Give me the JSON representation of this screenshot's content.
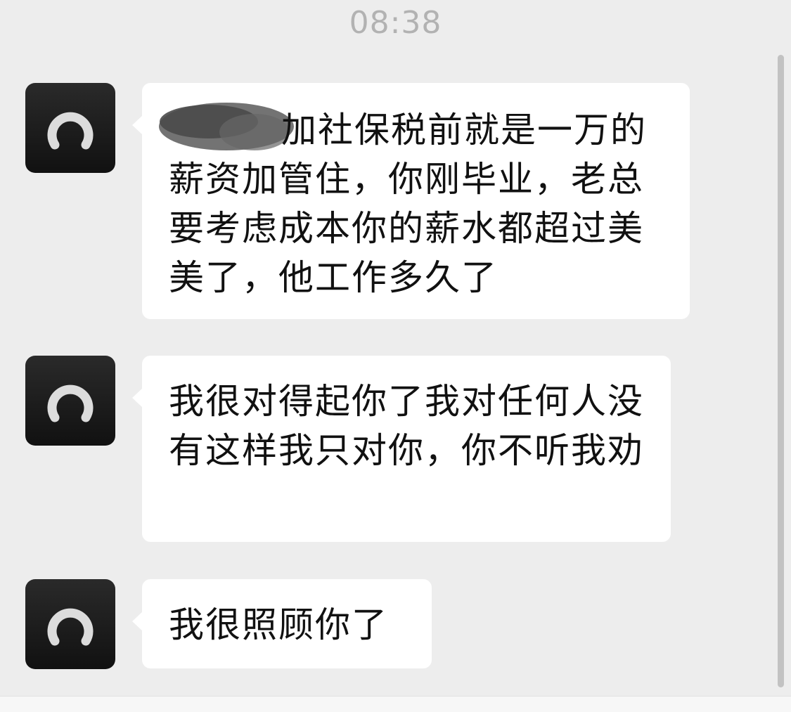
{
  "chat": {
    "timestamp": "08:38",
    "messages": [
      {
        "text": "加社保税前就是一万的薪资加管住，你刚毕业，老总要考虑成本你的薪水都超过美美了，他工作多久了"
      },
      {
        "text": "我很对得起你了我对任何人没有这样我只对你，你不听我劝"
      },
      {
        "text": "我很照顾你了"
      }
    ]
  },
  "colors": {
    "background": "#ededed",
    "bubble": "#ffffff",
    "timestamp": "#b2b2b2",
    "avatar": "#1a1a1a"
  }
}
